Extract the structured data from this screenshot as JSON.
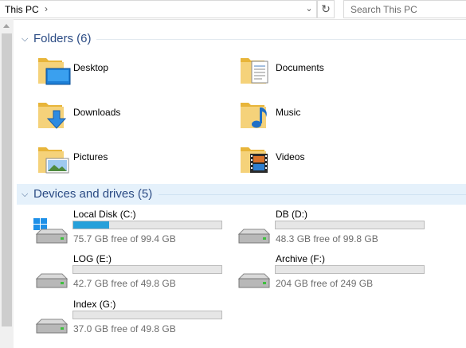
{
  "address": {
    "breadcrumb": "This PC",
    "separator": "›",
    "dropdown": "⌄",
    "refresh": "↻"
  },
  "search": {
    "placeholder": "Search This PC"
  },
  "folders_group": {
    "title": "Folders (6)",
    "chevron": "⌵"
  },
  "folders": [
    {
      "label": "Desktop",
      "icon": "desktop-folder-icon"
    },
    {
      "label": "Documents",
      "icon": "documents-folder-icon"
    },
    {
      "label": "Downloads",
      "icon": "downloads-folder-icon"
    },
    {
      "label": "Music",
      "icon": "music-folder-icon"
    },
    {
      "label": "Pictures",
      "icon": "pictures-folder-icon"
    },
    {
      "label": "Videos",
      "icon": "videos-folder-icon"
    }
  ],
  "drives_group": {
    "title": "Devices and drives (5)",
    "chevron": "⌵"
  },
  "drives": [
    {
      "label": "Local Disk (C:)",
      "free": "75.7 GB free of 99.4 GB",
      "used_fraction": 0.24,
      "icon": "system-drive-icon"
    },
    {
      "label": "DB (D:)",
      "free": "48.3 GB free of 99.8 GB",
      "used_fraction": 0.0,
      "icon": "hard-drive-icon"
    },
    {
      "label": "LOG (E:)",
      "free": "42.7 GB free of 49.8 GB",
      "used_fraction": 0.0,
      "icon": "hard-drive-icon"
    },
    {
      "label": "Archive (F:)",
      "free": "204 GB free of 249 GB",
      "used_fraction": 0.0,
      "icon": "hard-drive-icon"
    },
    {
      "label": "Index (G:)",
      "free": "37.0 GB free of 49.8 GB",
      "used_fraction": 0.0,
      "icon": "hard-drive-icon"
    }
  ],
  "colors": {
    "accent": "#26a0da",
    "group_title": "#2b4b84",
    "folder_yellow": "#f5c94c"
  }
}
